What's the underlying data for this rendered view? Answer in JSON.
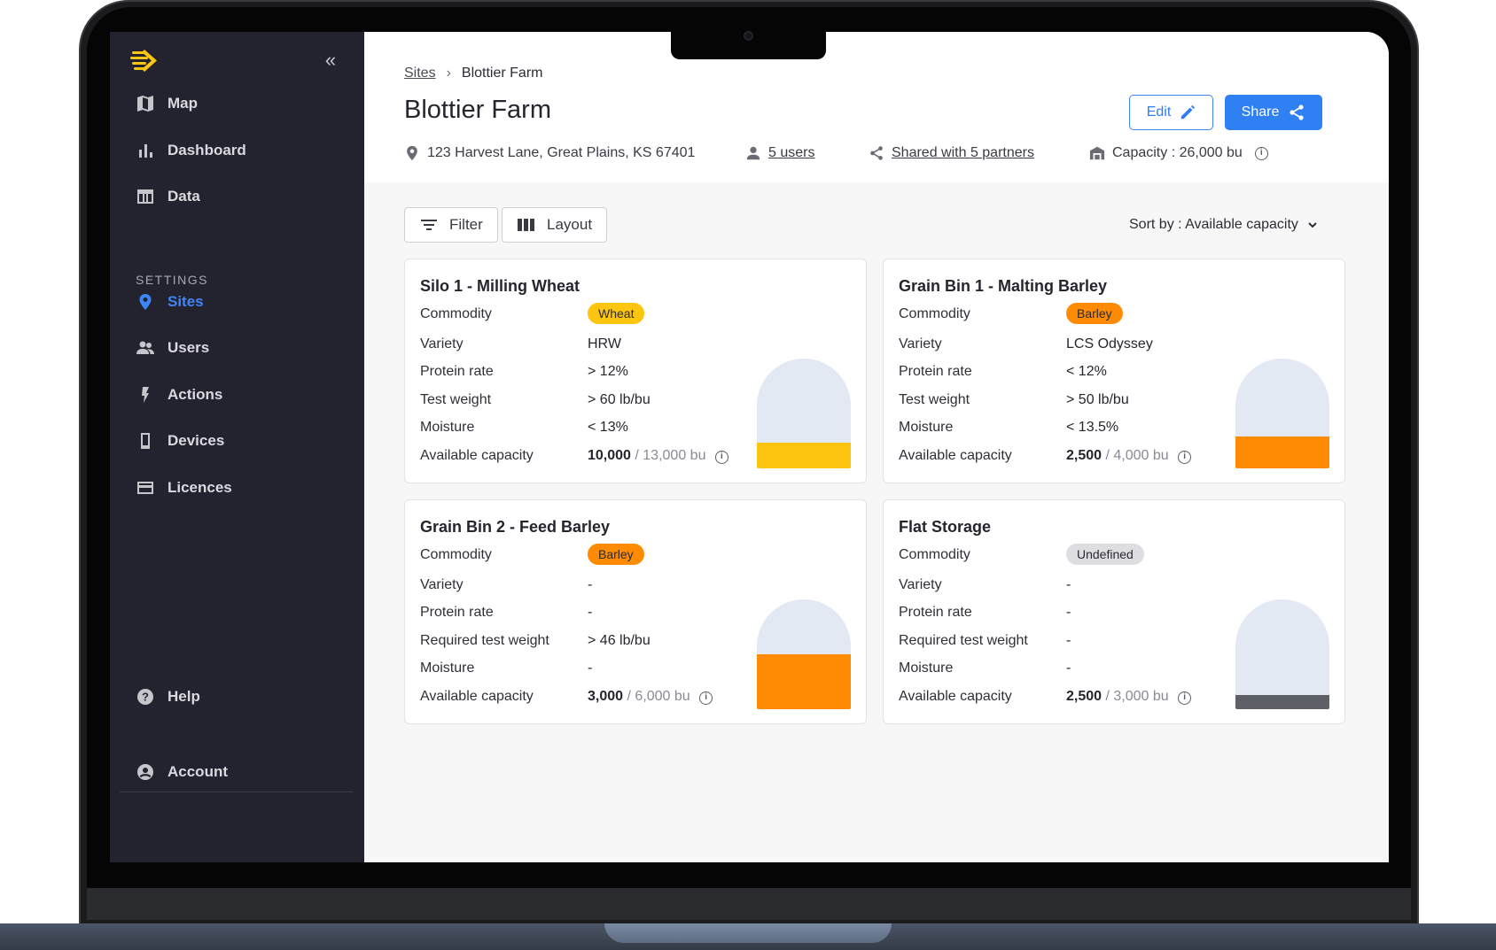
{
  "sidebar": {
    "nav": [
      {
        "label": "Map",
        "icon": "map-icon"
      },
      {
        "label": "Dashboard",
        "icon": "bar-chart-icon"
      },
      {
        "label": "Data",
        "icon": "table-icon"
      }
    ],
    "settings_label": "SETTINGS",
    "settings_nav": [
      {
        "label": "Sites",
        "icon": "location-pin-icon",
        "active": true
      },
      {
        "label": "Users",
        "icon": "users-icon"
      },
      {
        "label": "Actions",
        "icon": "bolt-icon"
      },
      {
        "label": "Devices",
        "icon": "device-icon"
      },
      {
        "label": "Licences",
        "icon": "card-icon"
      }
    ],
    "help": "Help",
    "account": "Account"
  },
  "header": {
    "breadcrumb_root": "Sites",
    "breadcrumb_current": "Blottier Farm",
    "title": "Blottier Farm",
    "edit_label": "Edit",
    "share_label": "Share",
    "address": "123 Harvest Lane, Great Plains, KS 67401",
    "users": "5 users",
    "shared": "Shared with 5 partners",
    "capacity": "Capacity : 26,000 bu"
  },
  "toolbar": {
    "filter_label": "Filter",
    "layout_label": "Layout",
    "sort_label": "Sort by : Available capacity"
  },
  "colors": {
    "accent": "#2f80f2",
    "wheat": "#fcc50f",
    "barley": "#ff8a04",
    "undefined": "#dedee2",
    "empty_fill": "#5d6066"
  },
  "cards": [
    {
      "title": "Silo 1 - Milling Wheat",
      "commodity_label": "Commodity",
      "commodity": "Wheat",
      "commodity_color": "#fcc50f",
      "variety_label": "Variety",
      "variety": "HRW",
      "protein_label": "Protein rate",
      "protein": "> 12%",
      "weight_label": "Test weight",
      "weight": "> 60 lb/bu",
      "moisture_label": "Moisture",
      "moisture": "< 13%",
      "capacity_label": "Available capacity",
      "capacity_available": "10,000",
      "capacity_total": "/ 13,000 bu",
      "fill_level": 0.23,
      "fill_color": "#fcc50f"
    },
    {
      "title": "Grain Bin 1 - Malting Barley",
      "commodity_label": "Commodity",
      "commodity": "Barley",
      "commodity_color": "#ff8a04",
      "variety_label": "Variety",
      "variety": "LCS Odyssey",
      "protein_label": "Protein rate",
      "protein": "< 12%",
      "weight_label": "Test weight",
      "weight": "> 50 lb/bu",
      "moisture_label": "Moisture",
      "moisture": "< 13.5%",
      "capacity_label": "Available capacity",
      "capacity_available": "2,500",
      "capacity_total": "/ 4,000 bu",
      "fill_level": 0.29,
      "fill_color": "#ff8a04"
    },
    {
      "title": "Grain Bin 2 - Feed Barley",
      "commodity_label": "Commodity",
      "commodity": "Barley",
      "commodity_color": "#ff8a04",
      "variety_label": "Variety",
      "variety": "-",
      "protein_label": "Protein rate",
      "protein": "-",
      "weight_label": "Required test weight",
      "weight": "> 46 lb/bu",
      "moisture_label": "Moisture",
      "moisture": "-",
      "capacity_label": "Available capacity",
      "capacity_available": "3,000",
      "capacity_total": "/ 6,000 bu",
      "fill_level": 0.5,
      "fill_color": "#ff8a04"
    },
    {
      "title": "Flat Storage",
      "commodity_label": "Commodity",
      "commodity": "Undefined",
      "commodity_color": "#dedee2",
      "variety_label": "Variety",
      "variety": "-",
      "protein_label": "Protein rate",
      "protein": "-",
      "weight_label": "Required test weight",
      "weight": "-",
      "moisture_label": "Moisture",
      "moisture": "-",
      "capacity_label": "Available capacity",
      "capacity_available": "2,500",
      "capacity_total": "/ 3,000 bu",
      "fill_level": 0.13,
      "fill_color": "#5d6066"
    }
  ]
}
